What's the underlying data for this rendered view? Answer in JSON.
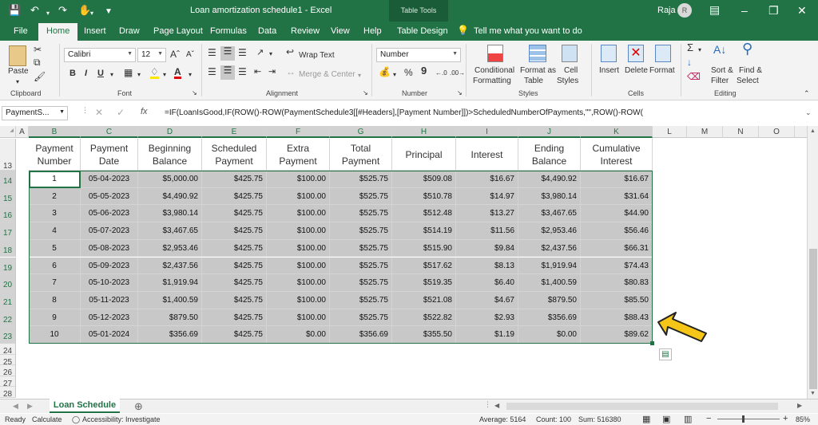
{
  "window": {
    "title": "Loan amortization schedule1  -  Excel",
    "context_tab": "Table Tools",
    "user_name": "Raja",
    "user_initial": "R"
  },
  "tabs": [
    "File",
    "Home",
    "Insert",
    "Draw",
    "Page Layout",
    "Formulas",
    "Data",
    "Review",
    "View",
    "Help",
    "Table Design"
  ],
  "active_tab": "Home",
  "tell_me": "Tell me what you want to do",
  "ribbon": {
    "clipboard": {
      "paste": "Paste",
      "label": "Clipboard"
    },
    "font": {
      "name": "Calibri",
      "size": "12",
      "label": "Font",
      "bold": "B",
      "italic": "I",
      "underline": "U"
    },
    "alignment": {
      "wrap_text": "Wrap Text",
      "merge_center": "Merge & Center",
      "label": "Alignment"
    },
    "number": {
      "format": "Number",
      "percent": "%",
      "comma": "9",
      "label": "Number"
    },
    "styles": {
      "conditional": "Conditional",
      "conditional2": "Formatting",
      "format_as": "Format as",
      "format_as2": "Table",
      "cell": "Cell",
      "cell2": "Styles",
      "label": "Styles"
    },
    "cells": {
      "insert": "Insert",
      "delete": "Delete",
      "format": "Format",
      "label": "Cells"
    },
    "editing": {
      "sort": "Sort &",
      "sort2": "Filter",
      "find": "Find &",
      "find2": "Select",
      "label": "Editing"
    }
  },
  "formula_bar": {
    "name_box": "PaymentS...",
    "fx": "fx",
    "formula": "=IF(LoanIsGood,IF(ROW()-ROW(PaymentSchedule3[[#Headers],[Payment Number]])>ScheduledNumberOfPayments,\"\",ROW()-ROW("
  },
  "columns": [
    "A",
    "B",
    "C",
    "D",
    "E",
    "F",
    "G",
    "H",
    "I",
    "J",
    "K",
    "L",
    "M",
    "N",
    "O"
  ],
  "row_numbers": [
    "13",
    "14",
    "15",
    "16",
    "17",
    "18",
    "19",
    "20",
    "21",
    "22",
    "23",
    "24",
    "25",
    "26",
    "27",
    "28"
  ],
  "table": {
    "headers": [
      [
        "Payment",
        "Number"
      ],
      [
        "Payment",
        "Date"
      ],
      [
        "Beginning",
        "Balance"
      ],
      [
        "Scheduled",
        "Payment"
      ],
      [
        "Extra",
        "Payment"
      ],
      [
        "Total",
        "Payment"
      ],
      [
        "Principal",
        ""
      ],
      [
        "Interest",
        ""
      ],
      [
        "Ending",
        "Balance"
      ],
      [
        "Cumulative",
        "Interest"
      ]
    ],
    "rows": [
      [
        "1",
        "05-04-2023",
        "$5,000.00",
        "$425.75",
        "$100.00",
        "$525.75",
        "$509.08",
        "$16.67",
        "$4,490.92",
        "$16.67"
      ],
      [
        "2",
        "05-05-2023",
        "$4,490.92",
        "$425.75",
        "$100.00",
        "$525.75",
        "$510.78",
        "$14.97",
        "$3,980.14",
        "$31.64"
      ],
      [
        "3",
        "05-06-2023",
        "$3,980.14",
        "$425.75",
        "$100.00",
        "$525.75",
        "$512.48",
        "$13.27",
        "$3,467.65",
        "$44.90"
      ],
      [
        "4",
        "05-07-2023",
        "$3,467.65",
        "$425.75",
        "$100.00",
        "$525.75",
        "$514.19",
        "$11.56",
        "$2,953.46",
        "$56.46"
      ],
      [
        "5",
        "05-08-2023",
        "$2,953.46",
        "$425.75",
        "$100.00",
        "$525.75",
        "$515.90",
        "$9.84",
        "$2,437.56",
        "$66.31"
      ],
      [
        "6",
        "05-09-2023",
        "$2,437.56",
        "$425.75",
        "$100.00",
        "$525.75",
        "$517.62",
        "$8.13",
        "$1,919.94",
        "$74.43"
      ],
      [
        "7",
        "05-10-2023",
        "$1,919.94",
        "$425.75",
        "$100.00",
        "$525.75",
        "$519.35",
        "$6.40",
        "$1,400.59",
        "$80.83"
      ],
      [
        "8",
        "05-11-2023",
        "$1,400.59",
        "$425.75",
        "$100.00",
        "$525.75",
        "$521.08",
        "$4.67",
        "$879.50",
        "$85.50"
      ],
      [
        "9",
        "05-12-2023",
        "$879.50",
        "$425.75",
        "$100.00",
        "$525.75",
        "$522.82",
        "$2.93",
        "$356.69",
        "$88.43"
      ],
      [
        "10",
        "05-01-2024",
        "$356.69",
        "$425.75",
        "$0.00",
        "$356.69",
        "$355.50",
        "$1.19",
        "$0.00",
        "$89.62"
      ]
    ]
  },
  "sheet_tabs": [
    "Loan Schedule"
  ],
  "status": {
    "ready": "Ready",
    "calculate": "Calculate",
    "accessibility": "Accessibility: Investigate",
    "average": "Average: 5164",
    "count": "Count: 100",
    "sum": "Sum: 516380",
    "zoom": "85%"
  },
  "colors": {
    "excel_green": "#217346",
    "selection_gray": "#c8c8c8",
    "arrow_yellow": "#f5c518"
  }
}
